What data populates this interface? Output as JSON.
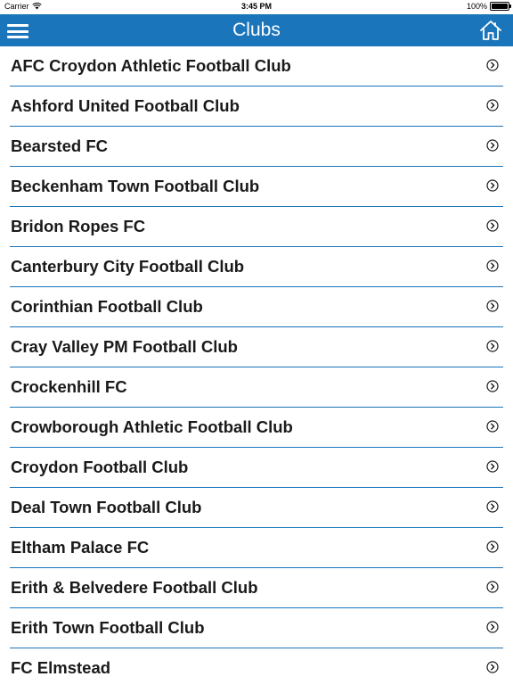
{
  "status_bar": {
    "carrier": "Carrier",
    "time": "3:45 PM",
    "battery": "100%"
  },
  "nav": {
    "title": "Clubs",
    "left_icon": "menu-icon",
    "right_icon": "home-icon"
  },
  "colors": {
    "accent": "#1b75bb",
    "text": "#1a1a1a"
  },
  "clubs": [
    {
      "label": "AFC Croydon Athletic Football Club"
    },
    {
      "label": "Ashford United Football Club"
    },
    {
      "label": "Bearsted FC"
    },
    {
      "label": "Beckenham Town Football Club"
    },
    {
      "label": "Bridon Ropes FC"
    },
    {
      "label": "Canterbury City Football Club"
    },
    {
      "label": "Corinthian Football Club"
    },
    {
      "label": "Cray Valley PM Football Club"
    },
    {
      "label": "Crockenhill FC"
    },
    {
      "label": "Crowborough Athletic Football Club"
    },
    {
      "label": "Croydon Football Club"
    },
    {
      "label": "Deal Town Football Club"
    },
    {
      "label": "Eltham Palace FC"
    },
    {
      "label": "Erith & Belvedere Football Club"
    },
    {
      "label": "Erith Town Football Club"
    },
    {
      "label": "FC Elmstead"
    }
  ]
}
